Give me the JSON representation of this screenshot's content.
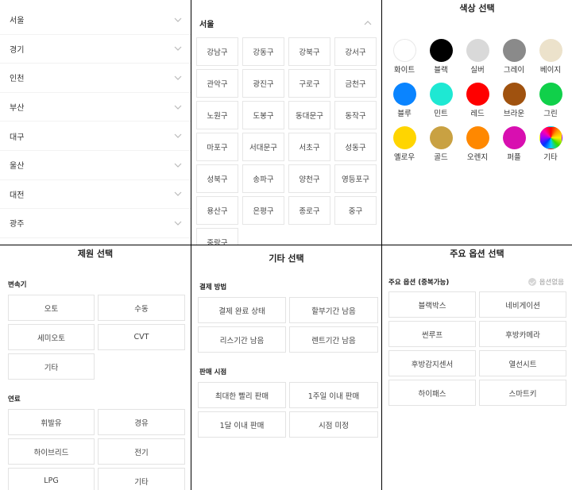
{
  "regions": [
    "서울",
    "경기",
    "인천",
    "부산",
    "대구",
    "울산",
    "대전",
    "광주"
  ],
  "district_panel": {
    "title": "서울",
    "districts": [
      "강남구",
      "강동구",
      "강북구",
      "강서구",
      "관악구",
      "광진구",
      "구로구",
      "금천구",
      "노원구",
      "도봉구",
      "동대문구",
      "동작구",
      "마포구",
      "서대문구",
      "서초구",
      "성동구",
      "성북구",
      "송파구",
      "양천구",
      "영등포구",
      "용산구",
      "은평구",
      "종로구",
      "중구",
      "중랑구"
    ]
  },
  "color_panel": {
    "title": "색상 선택",
    "colors": [
      {
        "label": "화이트",
        "hex": "#ffffff"
      },
      {
        "label": "블랙",
        "hex": "#000000"
      },
      {
        "label": "실버",
        "hex": "#d9d9d9"
      },
      {
        "label": "그레이",
        "hex": "#8a8a8a"
      },
      {
        "label": "베이지",
        "hex": "#ece2cb"
      },
      {
        "label": "블루",
        "hex": "#0a84ff"
      },
      {
        "label": "민트",
        "hex": "#1ee8d3"
      },
      {
        "label": "레드",
        "hex": "#ff0000"
      },
      {
        "label": "브라운",
        "hex": "#a0520f"
      },
      {
        "label": "그린",
        "hex": "#10d04a"
      },
      {
        "label": "옐로우",
        "hex": "#ffd500"
      },
      {
        "label": "골드",
        "hex": "#c9a142"
      },
      {
        "label": "오렌지",
        "hex": "#ff8800"
      },
      {
        "label": "퍼플",
        "hex": "#d80fb0"
      },
      {
        "label": "기타",
        "hex": "rainbow"
      }
    ]
  },
  "spec_panel": {
    "title": "제원 선택",
    "transmission_label": "변속기",
    "transmission": [
      "오토",
      "수동",
      "세미오토",
      "CVT",
      "기타"
    ],
    "fuel_label": "연료",
    "fuel": [
      "휘발유",
      "경유",
      "하이브리드",
      "전기",
      "LPG",
      "기타"
    ]
  },
  "etc_panel": {
    "title": "기타 선택",
    "payment_label": "결제 방법",
    "payment": [
      "결제 완료 상태",
      "할부기간 남음",
      "리스기간 남음",
      "렌트기간 남음"
    ],
    "sale_label": "판매 시점",
    "sale": [
      "최대한 빨리 판매",
      "1주일 이내 판매",
      "1달 이내 판매",
      "시점 미정"
    ]
  },
  "option_panel": {
    "title": "주요 옵션 선택",
    "section_label": "주요 옵션 (중복가능)",
    "none_label": "옵션없음",
    "options": [
      "블랙박스",
      "네비게이션",
      "썬루프",
      "후방카메라",
      "후방감지센서",
      "열선시트",
      "하이패스",
      "스마트키"
    ]
  }
}
